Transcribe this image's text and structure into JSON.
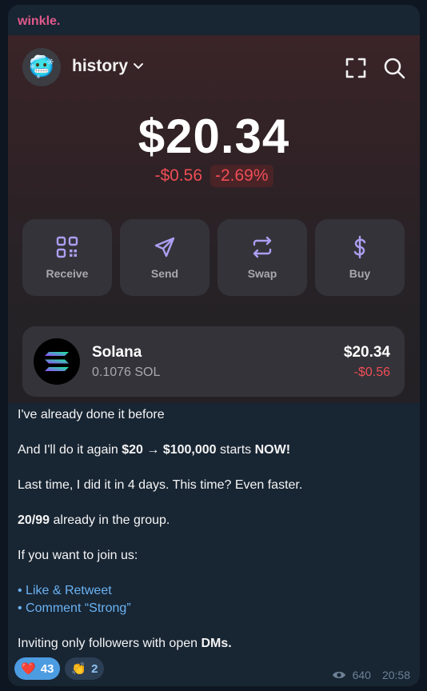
{
  "message": {
    "sender": "winkle.",
    "lines": [
      {
        "parts": [
          {
            "t": "I've already done it before",
            "b": false
          }
        ]
      },
      {
        "parts": [
          {
            "t": "And I'll do it again ",
            "b": false
          },
          {
            "t": "$20 → $100,000",
            "b": true
          },
          {
            "t": " starts ",
            "b": false
          },
          {
            "t": "NOW!",
            "b": true
          }
        ]
      },
      {
        "parts": [
          {
            "t": "Last time, I did it in 4 days. This time? Even faster.",
            "b": false
          }
        ]
      },
      {
        "parts": [
          {
            "t": "20/99",
            "b": true
          },
          {
            "t": " already in the group.",
            "b": false
          }
        ]
      },
      {
        "parts": [
          {
            "t": "If you want to join us:",
            "b": false
          }
        ]
      },
      {
        "parts": [
          {
            "t": "• Like & Retweet",
            "b": false,
            "link": true
          }
        ]
      },
      {
        "parts": [
          {
            "t": "• Comment “Strong”",
            "b": false,
            "link": true
          }
        ]
      },
      {
        "parts": [
          {
            "t": "Inviting only followers with open ",
            "b": false
          },
          {
            "t": "DMs.",
            "b": true
          }
        ]
      }
    ],
    "reactions": [
      {
        "emoji": "❤️",
        "count": "43",
        "active": true
      },
      {
        "emoji": "👏",
        "count": "2",
        "active": false
      }
    ],
    "views": "640",
    "time": "20:58"
  },
  "wallet": {
    "avatar_emoji": "🥶",
    "account_label": "history",
    "balance": "$20.34",
    "change_amount": "-$0.56",
    "change_percent": "-2.69%",
    "actions": [
      {
        "label": "Receive",
        "icon": "qr-code-icon"
      },
      {
        "label": "Send",
        "icon": "send-icon"
      },
      {
        "label": "Swap",
        "icon": "swap-icon"
      },
      {
        "label": "Buy",
        "icon": "dollar-icon"
      }
    ],
    "token": {
      "name": "Solana",
      "amount": "0.1076 SOL",
      "value": "$20.34",
      "change": "-$0.56"
    },
    "colors": {
      "accent_icon": "#ab9ff2",
      "negative": "#ef4d55"
    }
  }
}
